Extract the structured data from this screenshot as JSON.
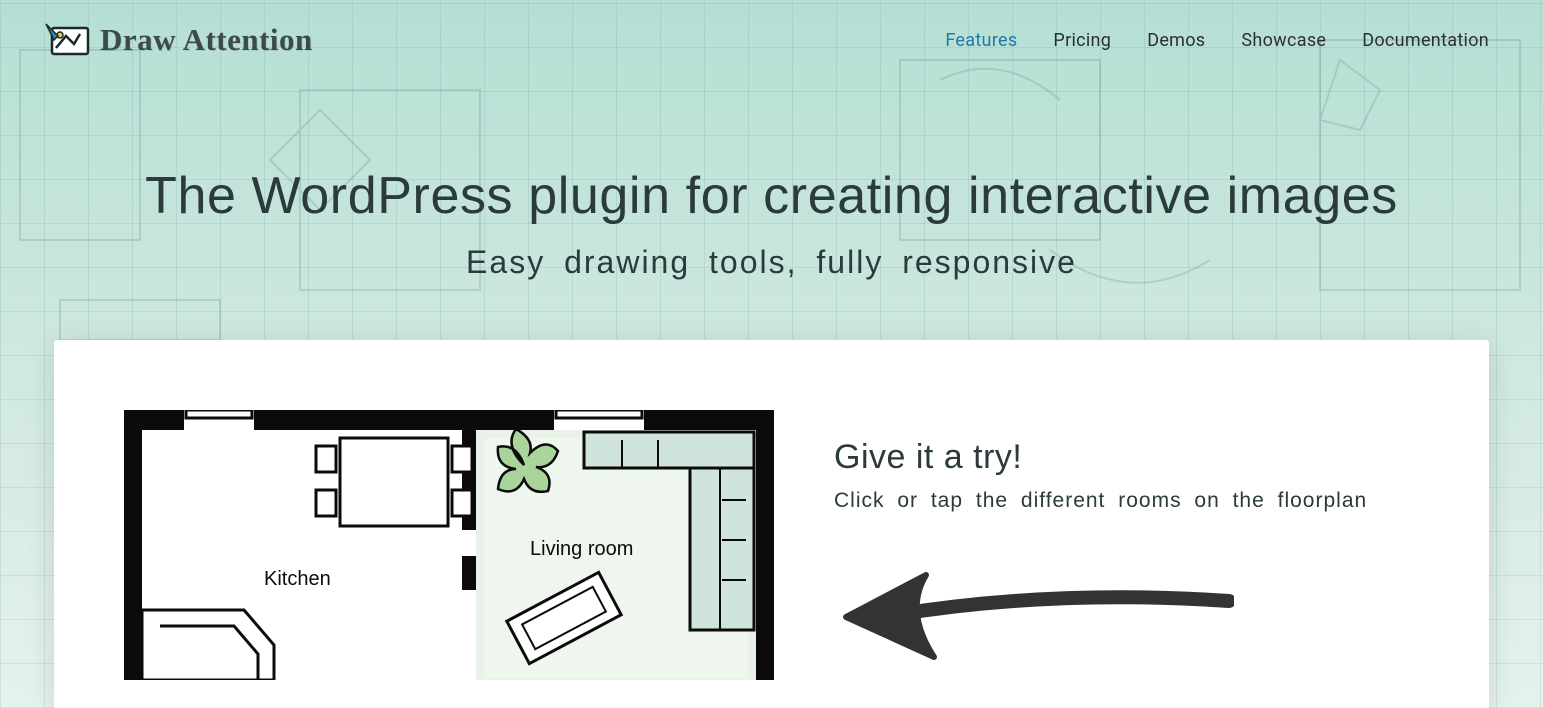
{
  "brand": {
    "name": "Draw Attention"
  },
  "nav": {
    "items": [
      {
        "label": "Features",
        "active": true
      },
      {
        "label": "Pricing",
        "active": false
      },
      {
        "label": "Demos",
        "active": false
      },
      {
        "label": "Showcase",
        "active": false
      },
      {
        "label": "Documentation",
        "active": false
      }
    ]
  },
  "hero": {
    "title": "The WordPress plugin for creating interactive images",
    "subtitle": "Easy drawing tools, fully responsive"
  },
  "demo": {
    "heading": "Give it a try!",
    "tip": "Click or tap the different rooms on the floorplan",
    "rooms": {
      "kitchen": "Kitchen",
      "living_room": "Living room"
    }
  },
  "colors": {
    "accent": "#1e7aa8",
    "text": "#2b3a3a",
    "bg_top": "#b5dfd4",
    "panel": "#ffffff"
  }
}
